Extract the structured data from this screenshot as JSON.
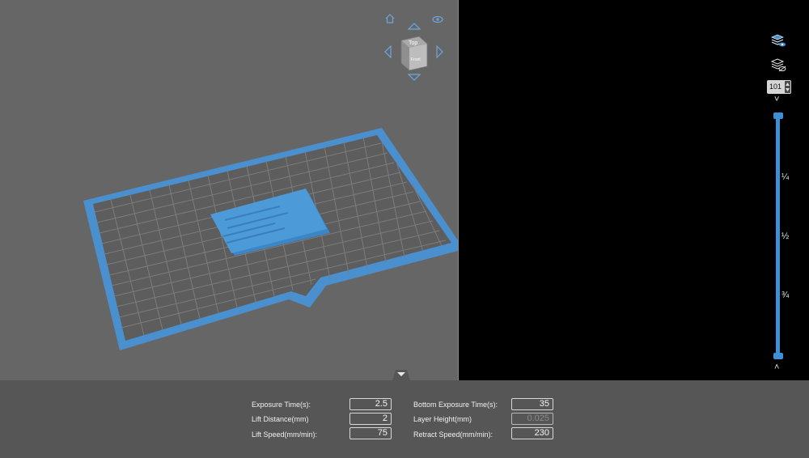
{
  "viewcube": {
    "top_face": "Top",
    "front_face": "Front"
  },
  "icons": {
    "home": "home-icon",
    "eye": "eye-icon",
    "arrows": [
      "arrow-up-icon",
      "arrow-down-icon",
      "arrow-left-icon",
      "arrow-right-icon"
    ],
    "layers_show": "layers-visible-icon",
    "layers_hide": "layers-hidden-icon",
    "collapse": "triangle-down-icon"
  },
  "layer_slider": {
    "current_layer": "101",
    "marks": [
      "¼",
      "½",
      "¾"
    ],
    "up_chevron": "˄",
    "down_chevron": "˅"
  },
  "params": {
    "exposure_time": {
      "label": "Exposure Time(s):",
      "value": "2.5"
    },
    "lift_distance": {
      "label": "Lift Distance(mm)",
      "value": "2"
    },
    "lift_speed": {
      "label": "Lift Speed(mm/min):",
      "value": "75"
    },
    "bottom_exposure_time": {
      "label": "Bottom Exposure Time(s):",
      "value": "35"
    },
    "layer_height": {
      "label": "Layer Height(mm)",
      "value": "0.025"
    },
    "retract_speed": {
      "label": "Retract Speed(mm/min):",
      "value": "230"
    }
  },
  "colors": {
    "accent": "#3d8fd6",
    "viewport_bg": "#666666",
    "layer_bg": "#000000",
    "panel_bg": "#565656"
  }
}
